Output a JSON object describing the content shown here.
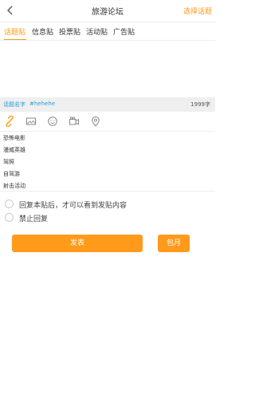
{
  "header": {
    "title": "旅游论坛",
    "choose_topic": "选择话题"
  },
  "tabs": [
    {
      "label": "话题贴",
      "active": true
    },
    {
      "label": "信息贴"
    },
    {
      "label": "投票贴"
    },
    {
      "label": "活动贴"
    },
    {
      "label": "广告贴"
    }
  ],
  "topic_bar": {
    "name_label": "话题名字",
    "tag": "#hehehe",
    "char_count": "1999字"
  },
  "toolbar": {
    "icons": [
      "link-icon",
      "image-icon",
      "emoji-icon",
      "video-icon",
      "location-icon"
    ],
    "accent_color": "#ff9a1a"
  },
  "topic_list": [
    "恐怖电影",
    "漫威英雄",
    "驾照",
    "自驾游",
    "射击活动"
  ],
  "options": [
    {
      "label": "回复本贴后，才可以看到发贴内容"
    },
    {
      "label": "禁止回复"
    }
  ],
  "buttons": {
    "publish": "发表",
    "monthly": "包月"
  }
}
